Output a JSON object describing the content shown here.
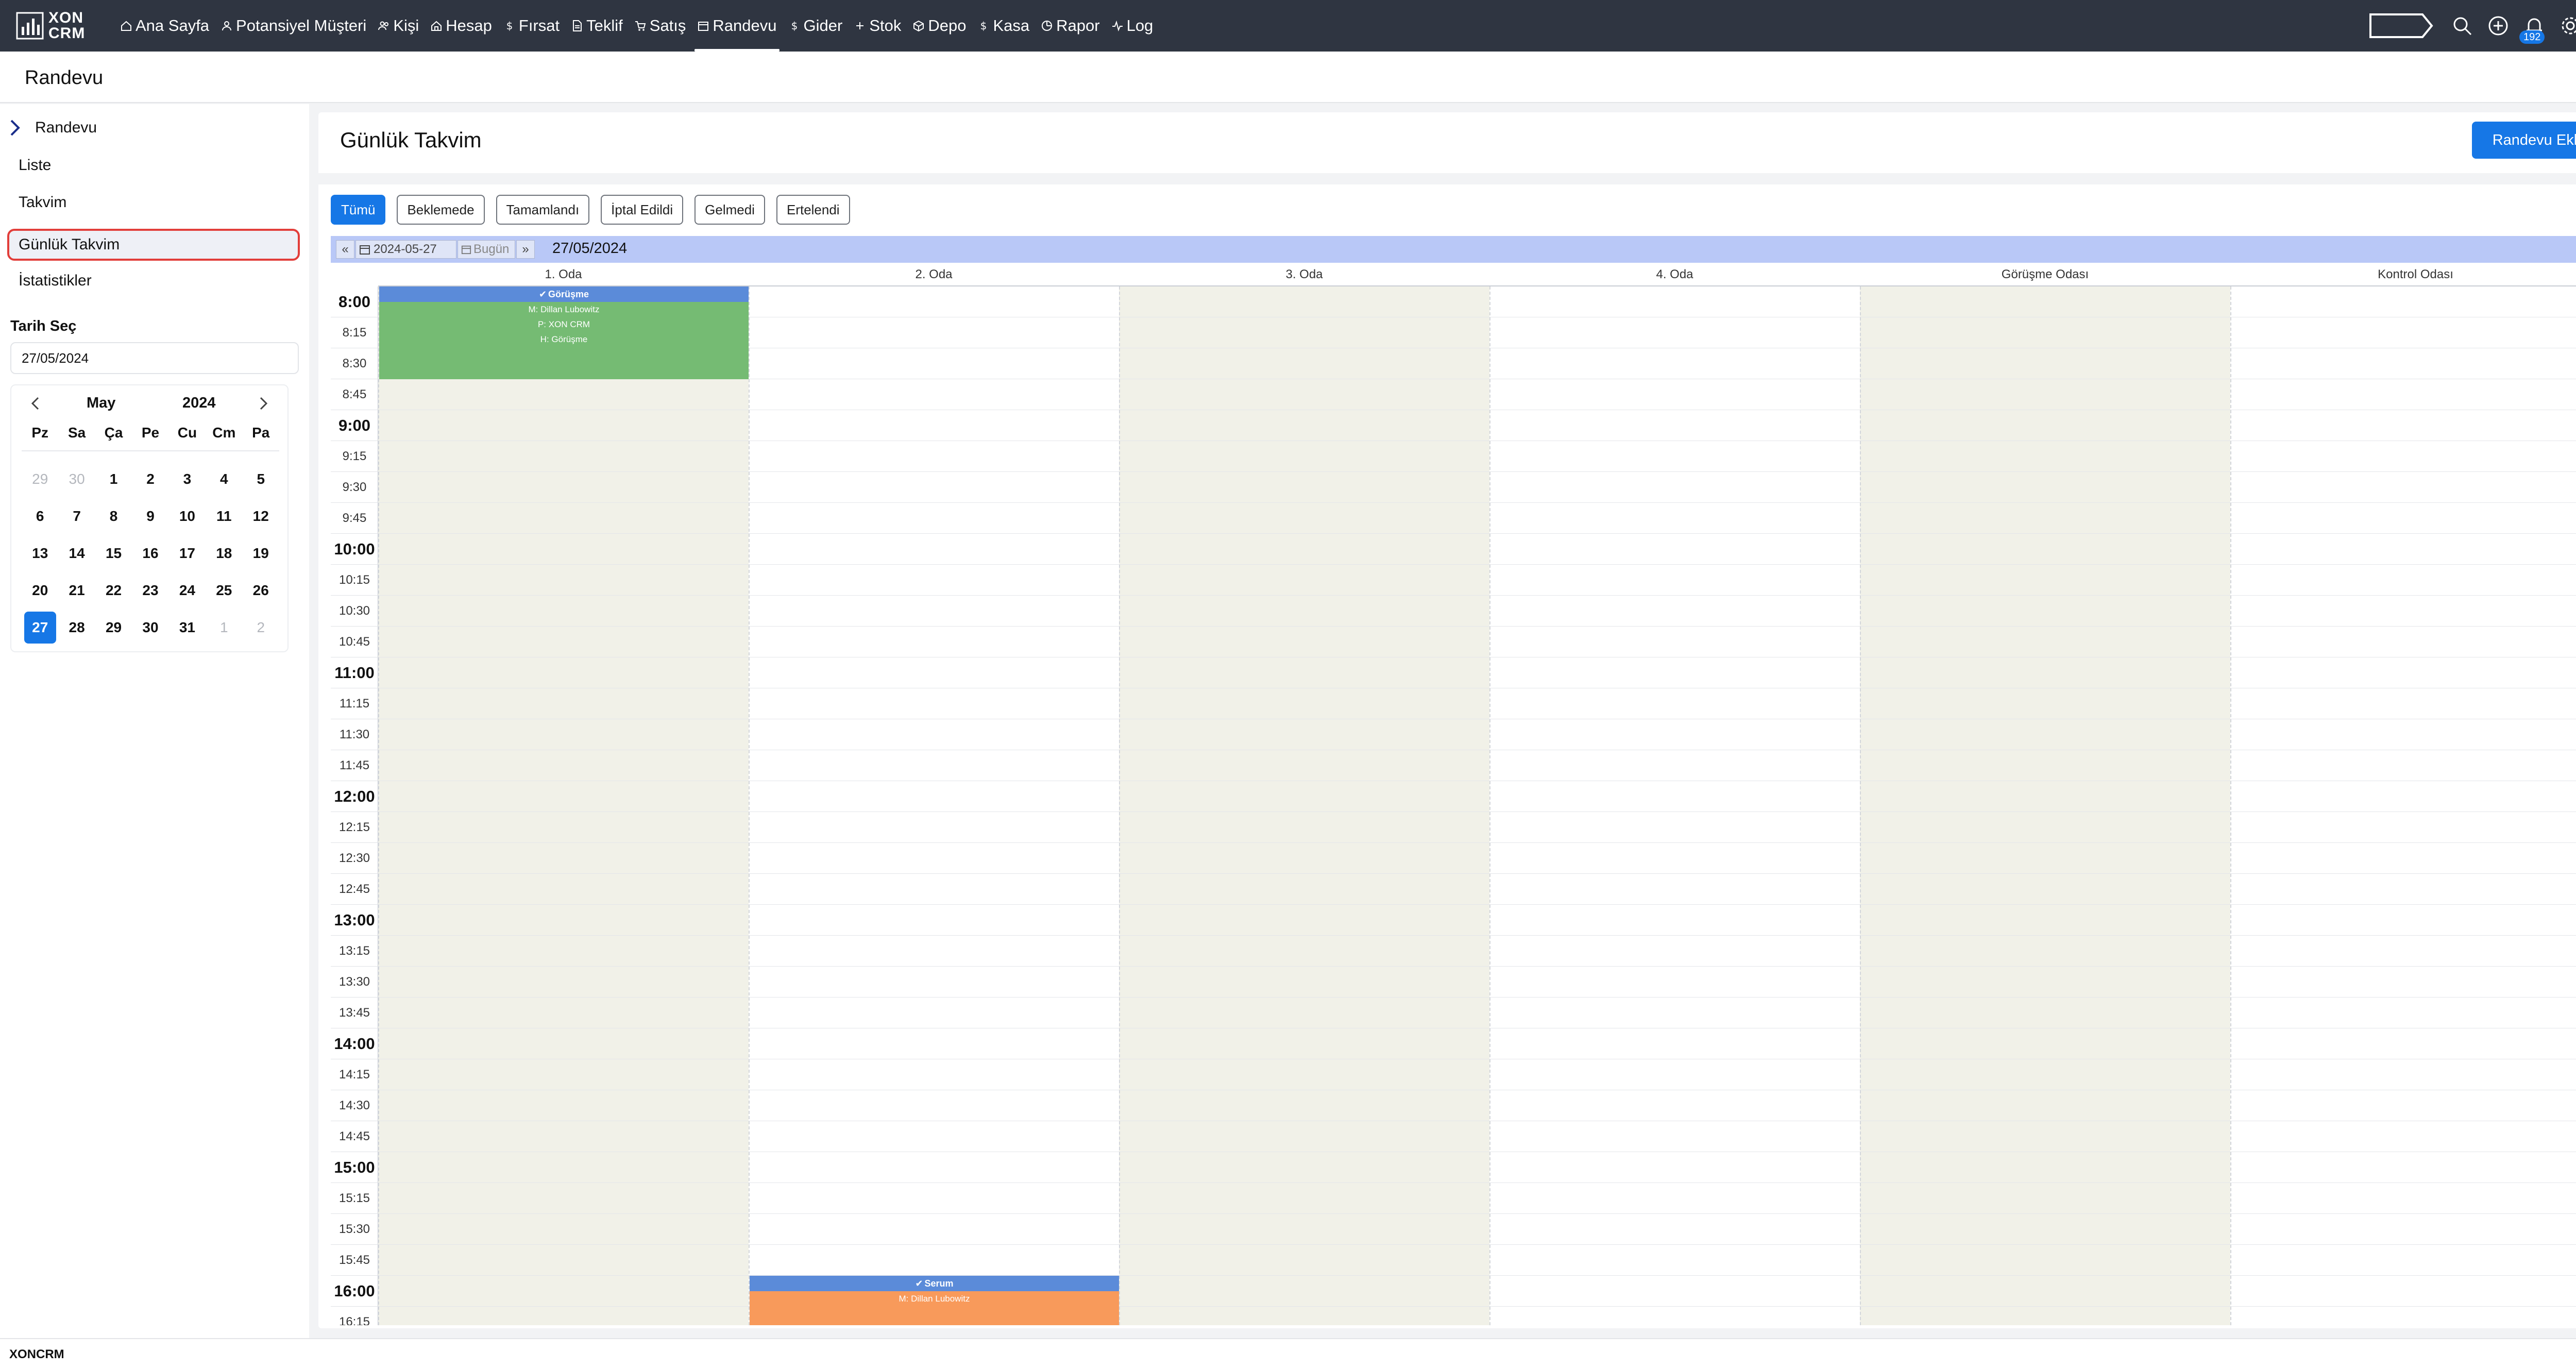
{
  "app": {
    "logo_line1": "XON",
    "logo_line2": "CRM",
    "notification_count": "192"
  },
  "nav": [
    {
      "label": "Ana Sayfa",
      "icon": "home-icon"
    },
    {
      "label": "Potansiyel Müşteri",
      "icon": "user-icon"
    },
    {
      "label": "Kişi",
      "icon": "users-icon"
    },
    {
      "label": "Hesap",
      "icon": "building-icon"
    },
    {
      "label": "Fırsat",
      "icon": "dollar-icon"
    },
    {
      "label": "Teklif",
      "icon": "document-icon"
    },
    {
      "label": "Satış",
      "icon": "cart-icon"
    },
    {
      "label": "Randevu",
      "icon": "calendar-icon",
      "active": true
    },
    {
      "label": "Gider",
      "icon": "dollar-icon"
    },
    {
      "label": "Stok",
      "icon": "plus-icon"
    },
    {
      "label": "Depo",
      "icon": "box-icon"
    },
    {
      "label": "Kasa",
      "icon": "dollar-icon"
    },
    {
      "label": "Rapor",
      "icon": "report-icon"
    },
    {
      "label": "Log",
      "icon": "activity-icon"
    }
  ],
  "page": {
    "title": "Randevu"
  },
  "sidebar": {
    "header": "Randevu",
    "items": [
      {
        "label": "Liste"
      },
      {
        "label": "Takvim"
      },
      {
        "label": "Günlük Takvim",
        "active": true
      },
      {
        "label": "İstatistikler"
      }
    ],
    "date_label": "Tarih Seç",
    "date_value": "27/05/2024"
  },
  "minical": {
    "month": "May",
    "year": "2024",
    "weekdays": [
      "Pz",
      "Sa",
      "Ça",
      "Pe",
      "Cu",
      "Cm",
      "Pa"
    ],
    "weeks": [
      [
        "29",
        "30",
        "1",
        "2",
        "3",
        "4",
        "5"
      ],
      [
        "6",
        "7",
        "8",
        "9",
        "10",
        "11",
        "12"
      ],
      [
        "13",
        "14",
        "15",
        "16",
        "17",
        "18",
        "19"
      ],
      [
        "20",
        "21",
        "22",
        "23",
        "24",
        "25",
        "26"
      ],
      [
        "27",
        "28",
        "29",
        "30",
        "31",
        "1",
        "2"
      ]
    ],
    "muted": [
      [
        0,
        0
      ],
      [
        0,
        1
      ],
      [
        4,
        5
      ],
      [
        4,
        6
      ]
    ],
    "selected": [
      4,
      0
    ]
  },
  "main": {
    "title": "Günlük Takvim",
    "add_button": "Randevu Ekle"
  },
  "filters": [
    {
      "label": "Tümü",
      "active": true
    },
    {
      "label": "Beklemede"
    },
    {
      "label": "Tamamlandı"
    },
    {
      "label": "İptal Edildi"
    },
    {
      "label": "Gelmedi"
    },
    {
      "label": "Ertelendi"
    }
  ],
  "scheduler": {
    "prev_label": "«",
    "date_iso": "2024-05-27",
    "today_label": "Bugün",
    "next_label": "»",
    "current_date": "27/05/2024",
    "rooms": [
      {
        "name": "1. Oda",
        "shaded": true
      },
      {
        "name": "2. Oda",
        "shaded": false
      },
      {
        "name": "3. Oda",
        "shaded": true
      },
      {
        "name": "4. Oda",
        "shaded": false
      },
      {
        "name": "Görüşme Odası",
        "shaded": true
      },
      {
        "name": "Kontrol Odası",
        "shaded": false
      }
    ],
    "times": [
      "8:00",
      "8:15",
      "8:30",
      "8:45",
      "9:00",
      "9:15",
      "9:30",
      "9:45",
      "10:00",
      "10:15",
      "10:30",
      "10:45",
      "11:00",
      "11:15",
      "11:30",
      "11:45",
      "12:00",
      "12:15",
      "12:30",
      "12:45",
      "13:00",
      "13:15",
      "13:30",
      "13:45",
      "14:00",
      "14:15",
      "14:30",
      "14:45",
      "15:00",
      "15:15",
      "15:30",
      "15:45",
      "16:00",
      "16:15"
    ],
    "events": [
      {
        "room": 0,
        "start": "8:00",
        "slots": 3,
        "title": "Görüşme",
        "color": "#75bb73",
        "lines": [
          "M: Dillan Lubowitz",
          "P: XON CRM",
          "H: Görüşme"
        ]
      },
      {
        "room": 1,
        "start": "16:00",
        "slots": 2,
        "title": "Serum",
        "color": "#f89a5b",
        "lines": [
          "M: Dillan Lubowitz"
        ]
      }
    ]
  },
  "footer": {
    "text": "XONCRM"
  }
}
